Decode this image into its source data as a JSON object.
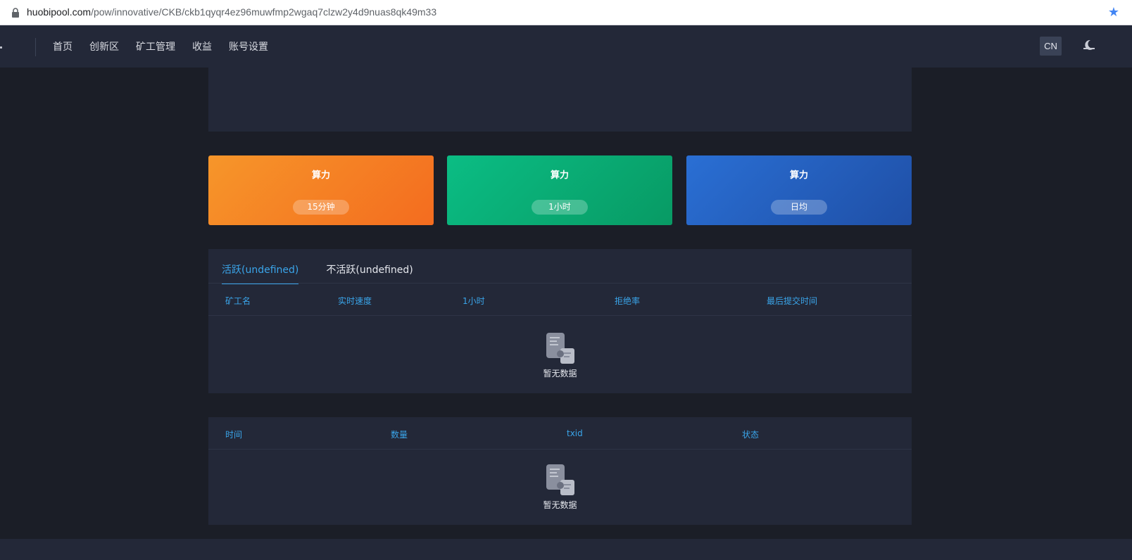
{
  "browser": {
    "url_host": "huobipool.com",
    "url_path": "/pow/innovative/CKB/ckb1qyqr4ez96muwfmp2wgaq7clzw2y4d9nuas8qk49m33"
  },
  "nav": {
    "items": [
      "首页",
      "创新区",
      "矿工管理",
      "收益",
      "账号设置"
    ],
    "lang": "CN"
  },
  "hashrate_cards": [
    {
      "title": "算力",
      "period": "15分钟",
      "color": "#f4801f"
    },
    {
      "title": "算力",
      "period": "1小时",
      "color": "#08ab73"
    },
    {
      "title": "算力",
      "period": "日均",
      "color": "#265fbd"
    }
  ],
  "workers": {
    "tabs": [
      {
        "label": "活跃(undefined)",
        "active": true
      },
      {
        "label": "不活跃(undefined)",
        "active": false
      }
    ],
    "columns": [
      "矿工名",
      "实时速度",
      "1小时",
      "拒绝率",
      "最后提交时间"
    ],
    "empty_text": "暂无数据"
  },
  "payments": {
    "columns": [
      "时间",
      "数量",
      "txid",
      "状态"
    ],
    "empty_text": "暂无数据"
  },
  "colors": {
    "accent": "#3aa5ea",
    "page_bg": "#1b1e27",
    "panel_bg": "#232838"
  }
}
